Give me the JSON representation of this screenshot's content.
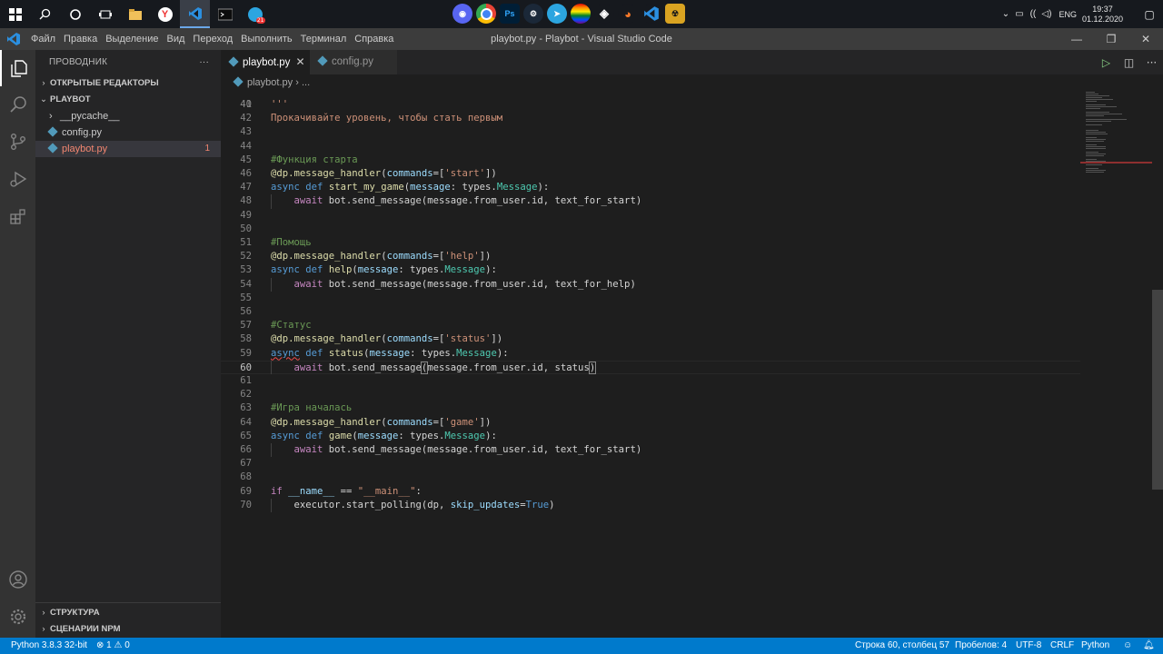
{
  "taskbar": {
    "left_icons": [
      "windows-start-icon",
      "search-icon",
      "cortana-circle-icon",
      "task-view-icon",
      "file-explorer-icon",
      "yandex-browser-icon",
      "vscode-taskbar-icon",
      "terminal-icon",
      "telegram-icon"
    ],
    "center_apps": [
      "discord",
      "chrome",
      "photoshop",
      "steam",
      "telegram",
      "lgbt-app",
      "unity",
      "blender",
      "vscode",
      "counter-strike"
    ],
    "lang": "ENG",
    "time": "19:37",
    "date": "01.12.2020"
  },
  "window": {
    "title": "playbot.py - Playbot - Visual Studio Code",
    "menu": [
      "Файл",
      "Правка",
      "Выделение",
      "Вид",
      "Переход",
      "Выполнить",
      "Терминал",
      "Справка"
    ]
  },
  "sidebar": {
    "header": "ПРОВОДНИК",
    "open_editors": "ОТКРЫТЫЕ РЕДАКТОРЫ",
    "project": "PLAYBOT",
    "items": [
      {
        "name": "__pycache__",
        "type": "folder"
      },
      {
        "name": "config.py",
        "type": "python"
      },
      {
        "name": "playbot.py",
        "type": "python",
        "errors": "1"
      }
    ],
    "outline": "СТРУКТУРА",
    "npm": "СЦЕНАРИИ NPM"
  },
  "tabs": [
    {
      "label": "playbot.py",
      "active": true
    },
    {
      "label": "config.py",
      "active": false
    }
  ],
  "breadcrumb": {
    "file": "playbot.py",
    "rest": "..."
  },
  "code": {
    "partial_line": {
      "num": "40",
      "text": "Прокачивайте уровень, чтобы стать первым"
    },
    "lines": [
      {
        "num": "41",
        "tokens": [
          [
            "str",
            "'''"
          ]
        ]
      },
      {
        "num": "42",
        "tokens": []
      },
      {
        "num": "43",
        "tokens": []
      },
      {
        "num": "44",
        "tokens": []
      },
      {
        "num": "45",
        "tokens": [
          [
            "cmt",
            "#Функция старта"
          ]
        ]
      },
      {
        "num": "46",
        "tokens": [
          [
            "fn",
            "@dp.message_handler"
          ],
          [
            "def",
            "("
          ],
          [
            "par",
            "commands"
          ],
          [
            "def",
            "=["
          ],
          [
            "str",
            "'start'"
          ],
          [
            "def",
            "])"
          ]
        ]
      },
      {
        "num": "47",
        "tokens": [
          [
            "kw",
            "async"
          ],
          [
            "def",
            " "
          ],
          [
            "kw",
            "def"
          ],
          [
            "def",
            " "
          ],
          [
            "fn",
            "start_my_game"
          ],
          [
            "def",
            "("
          ],
          [
            "par",
            "message"
          ],
          [
            "def",
            ": types."
          ],
          [
            "cls",
            "Message"
          ],
          [
            "def",
            "):"
          ]
        ]
      },
      {
        "num": "48",
        "tokens": [
          [
            "def",
            "    "
          ],
          [
            "ctl",
            "await"
          ],
          [
            "def",
            " bot.send_message(message.from_user.id, text_for_start)"
          ]
        ]
      },
      {
        "num": "49",
        "tokens": []
      },
      {
        "num": "50",
        "tokens": []
      },
      {
        "num": "51",
        "tokens": [
          [
            "cmt",
            "#Помощь"
          ]
        ]
      },
      {
        "num": "52",
        "tokens": [
          [
            "fn",
            "@dp.message_handler"
          ],
          [
            "def",
            "("
          ],
          [
            "par",
            "commands"
          ],
          [
            "def",
            "=["
          ],
          [
            "str",
            "'help'"
          ],
          [
            "def",
            "])"
          ]
        ]
      },
      {
        "num": "53",
        "tokens": [
          [
            "kw",
            "async"
          ],
          [
            "def",
            " "
          ],
          [
            "kw",
            "def"
          ],
          [
            "def",
            " "
          ],
          [
            "fn",
            "help"
          ],
          [
            "def",
            "("
          ],
          [
            "par",
            "message"
          ],
          [
            "def",
            ": types."
          ],
          [
            "cls",
            "Message"
          ],
          [
            "def",
            "):"
          ]
        ]
      },
      {
        "num": "54",
        "tokens": [
          [
            "def",
            "    "
          ],
          [
            "ctl",
            "await"
          ],
          [
            "def",
            " bot.send_message(message.from_user.id, text_for_help)"
          ]
        ]
      },
      {
        "num": "55",
        "tokens": []
      },
      {
        "num": "56",
        "tokens": []
      },
      {
        "num": "57",
        "tokens": [
          [
            "cmt",
            "#Статус"
          ]
        ]
      },
      {
        "num": "58",
        "tokens": [
          [
            "fn",
            "@dp.message_handler"
          ],
          [
            "def",
            "("
          ],
          [
            "par",
            "commands"
          ],
          [
            "def",
            "=["
          ],
          [
            "str",
            "'status'"
          ],
          [
            "def",
            "])"
          ]
        ]
      },
      {
        "num": "59",
        "tokens": [
          [
            "kwsq",
            "async"
          ],
          [
            "def",
            " "
          ],
          [
            "kw",
            "def"
          ],
          [
            "def",
            " "
          ],
          [
            "fn",
            "status"
          ],
          [
            "def",
            "("
          ],
          [
            "par",
            "message"
          ],
          [
            "def",
            ": types."
          ],
          [
            "cls",
            "Message"
          ],
          [
            "def",
            "):"
          ]
        ]
      },
      {
        "num": "60",
        "current": true,
        "tokens": [
          [
            "def",
            "    "
          ],
          [
            "ctl",
            "await"
          ],
          [
            "def",
            " bot.send_message"
          ],
          [
            "br",
            "("
          ],
          [
            "def",
            "message.from_user.id, status"
          ],
          [
            "br",
            ")"
          ]
        ]
      },
      {
        "num": "61",
        "tokens": []
      },
      {
        "num": "62",
        "tokens": []
      },
      {
        "num": "63",
        "tokens": [
          [
            "cmt",
            "#Игра началась"
          ]
        ]
      },
      {
        "num": "64",
        "tokens": [
          [
            "fn",
            "@dp.message_handler"
          ],
          [
            "def",
            "("
          ],
          [
            "par",
            "commands"
          ],
          [
            "def",
            "=["
          ],
          [
            "str",
            "'game'"
          ],
          [
            "def",
            "])"
          ]
        ]
      },
      {
        "num": "65",
        "tokens": [
          [
            "kw",
            "async"
          ],
          [
            "def",
            " "
          ],
          [
            "kw",
            "def"
          ],
          [
            "def",
            " "
          ],
          [
            "fn",
            "game"
          ],
          [
            "def",
            "("
          ],
          [
            "par",
            "message"
          ],
          [
            "def",
            ": types."
          ],
          [
            "cls",
            "Message"
          ],
          [
            "def",
            "):"
          ]
        ]
      },
      {
        "num": "66",
        "tokens": [
          [
            "def",
            "    "
          ],
          [
            "ctl",
            "await"
          ],
          [
            "def",
            " bot.send_message(message.from_user.id, text_for_start)"
          ]
        ]
      },
      {
        "num": "67",
        "tokens": []
      },
      {
        "num": "68",
        "tokens": []
      },
      {
        "num": "69",
        "tokens": [
          [
            "ctl",
            "if"
          ],
          [
            "def",
            " "
          ],
          [
            "par",
            "__name__"
          ],
          [
            "def",
            " == "
          ],
          [
            "str",
            "\"__main__\""
          ],
          [
            "def",
            ":"
          ]
        ]
      },
      {
        "num": "70",
        "tokens": [
          [
            "def",
            "    executor.start_polling(dp, "
          ],
          [
            "par",
            "skip_updates"
          ],
          [
            "def",
            "="
          ],
          [
            "kw",
            "True"
          ],
          [
            "def",
            ")"
          ]
        ]
      }
    ]
  },
  "statusbar": {
    "python": "Python 3.8.3 32-bit",
    "errors": "1",
    "warnings": "0",
    "position": "Строка 60, столбец 57",
    "spaces": "Пробелов: 4",
    "encoding": "UTF-8",
    "eol": "CRLF",
    "language": "Python"
  },
  "colors": {
    "accent": "#007acc",
    "error": "#f48771"
  }
}
